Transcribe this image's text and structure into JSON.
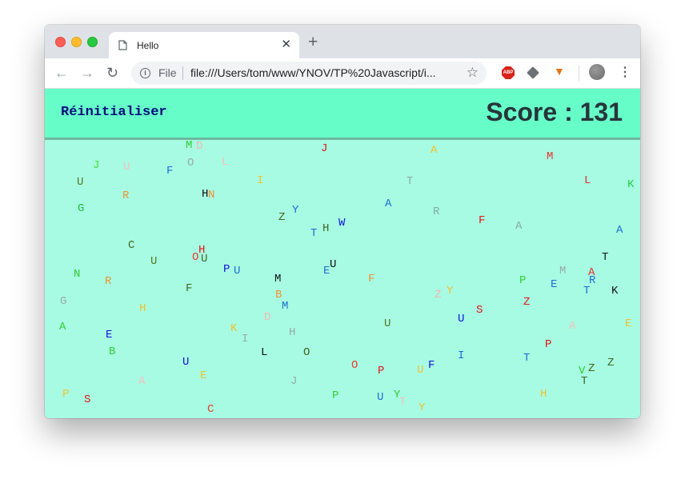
{
  "tab": {
    "title": "Hello"
  },
  "toolbar": {
    "scheme": "File",
    "url": "file:///Users/tom/www/YNOV/TP%20Javascript/i..."
  },
  "game": {
    "reset_label": "Réinitialiser",
    "score_label": "Score : 131"
  },
  "letters": [
    [
      "M",
      "#33cc33"
    ],
    [
      "D",
      "#f5b5b5"
    ],
    [
      "J",
      "#e51515"
    ],
    [
      "A",
      "#f2c12e"
    ],
    [
      "M",
      "#e83030"
    ],
    [
      "J",
      "#44dd33"
    ],
    [
      "U",
      "#f5c0c0"
    ],
    [
      "F",
      "#1f6ed1"
    ],
    [
      "O",
      "#99aaaa"
    ],
    [
      "L",
      "#f5c0c0"
    ],
    [
      "U",
      "#557722"
    ],
    [
      "I",
      "#f2c12e"
    ],
    [
      "T",
      "#88aaaa"
    ],
    [
      "L",
      "#e83030"
    ],
    [
      "K",
      "#22cc44"
    ],
    [
      "R",
      "#f09030"
    ],
    [
      "H",
      "#111111"
    ],
    [
      "N",
      "#f09030"
    ],
    [
      "G",
      "#22bb44"
    ],
    [
      "A",
      "#1f6ed1"
    ],
    [
      "R",
      "#88aaaa"
    ],
    [
      "Z",
      "#446622"
    ],
    [
      "Y",
      "#1f6ed1"
    ],
    [
      "H",
      "#446622"
    ],
    [
      "W",
      "#1111dd"
    ],
    [
      "T",
      "#1f6ed1"
    ],
    [
      "F",
      "#e51515"
    ],
    [
      "A",
      "#88aaaa"
    ],
    [
      "A",
      "#1f6ed1"
    ],
    [
      "C",
      "#446622"
    ],
    [
      "U",
      "#557722"
    ],
    [
      "H",
      "#e51515"
    ],
    [
      "O",
      "#e84030"
    ],
    [
      "U",
      "#446622"
    ],
    [
      "T",
      "#111111"
    ],
    [
      "P",
      "#1111dd"
    ],
    [
      "U",
      "#1f6ed1"
    ],
    [
      "M",
      "#99aaaa"
    ],
    [
      "A",
      "#e83030"
    ],
    [
      "N",
      "#33cc33"
    ],
    [
      "R",
      "#f09030"
    ],
    [
      "M",
      "#111111"
    ],
    [
      "E",
      "#1f6ed1"
    ],
    [
      "U",
      "#111111"
    ],
    [
      "F",
      "#f09030"
    ],
    [
      "P",
      "#33cc33"
    ],
    [
      "E",
      "#1f6ed1"
    ],
    [
      "R",
      "#1f6ed1"
    ],
    [
      "T",
      "#1f6ed1"
    ],
    [
      "K",
      "#111111"
    ],
    [
      "F",
      "#446622"
    ],
    [
      "B",
      "#f09030"
    ],
    [
      "Z",
      "#f5b5b5"
    ],
    [
      "Y",
      "#f2c12e"
    ],
    [
      "Z",
      "#e51515"
    ],
    [
      "G",
      "#99aaaa"
    ],
    [
      "H",
      "#f2c12e"
    ],
    [
      "M",
      "#1f6ed1"
    ],
    [
      "S",
      "#e51515"
    ],
    [
      "U",
      "#1111dd"
    ],
    [
      "D",
      "#f5b5b5"
    ],
    [
      "A",
      "#33cc33"
    ],
    [
      "K",
      "#f2c12e"
    ],
    [
      "H",
      "#99aaaa"
    ],
    [
      "U",
      "#557722"
    ],
    [
      "A",
      "#f5c0c0"
    ],
    [
      "E",
      "#f2c12e"
    ],
    [
      "E",
      "#1111dd"
    ],
    [
      "I",
      "#99aaaa"
    ],
    [
      "P",
      "#e51515"
    ],
    [
      "B",
      "#33cc33"
    ],
    [
      "L",
      "#111111"
    ],
    [
      "O",
      "#446622"
    ],
    [
      "I",
      "#1f6ed1"
    ],
    [
      "T",
      "#1f6ed1"
    ],
    [
      "Z",
      "#446622"
    ],
    [
      "U",
      "#1111dd"
    ],
    [
      "O",
      "#e84030"
    ],
    [
      "U",
      "#f2c12e"
    ],
    [
      "F",
      "#1111dd"
    ],
    [
      "V",
      "#33cc33"
    ],
    [
      "Z",
      "#446622"
    ],
    [
      "E",
      "#f2c12e"
    ],
    [
      "P",
      "#e51515"
    ],
    [
      "T",
      "#446622"
    ],
    [
      "A",
      "#f5c0c0"
    ],
    [
      "J",
      "#99aaaa"
    ],
    [
      "P",
      "#f2c12e"
    ],
    [
      "S",
      "#e51515"
    ],
    [
      "P",
      "#33cc33"
    ],
    [
      "Y",
      "#33cc33"
    ],
    [
      "U",
      "#1f6ed1"
    ],
    [
      "T",
      "#f5c0c0"
    ],
    [
      "H",
      "#f2c12e"
    ],
    [
      "Y",
      "#f2c12e"
    ],
    [
      "C",
      "#e84030"
    ]
  ]
}
